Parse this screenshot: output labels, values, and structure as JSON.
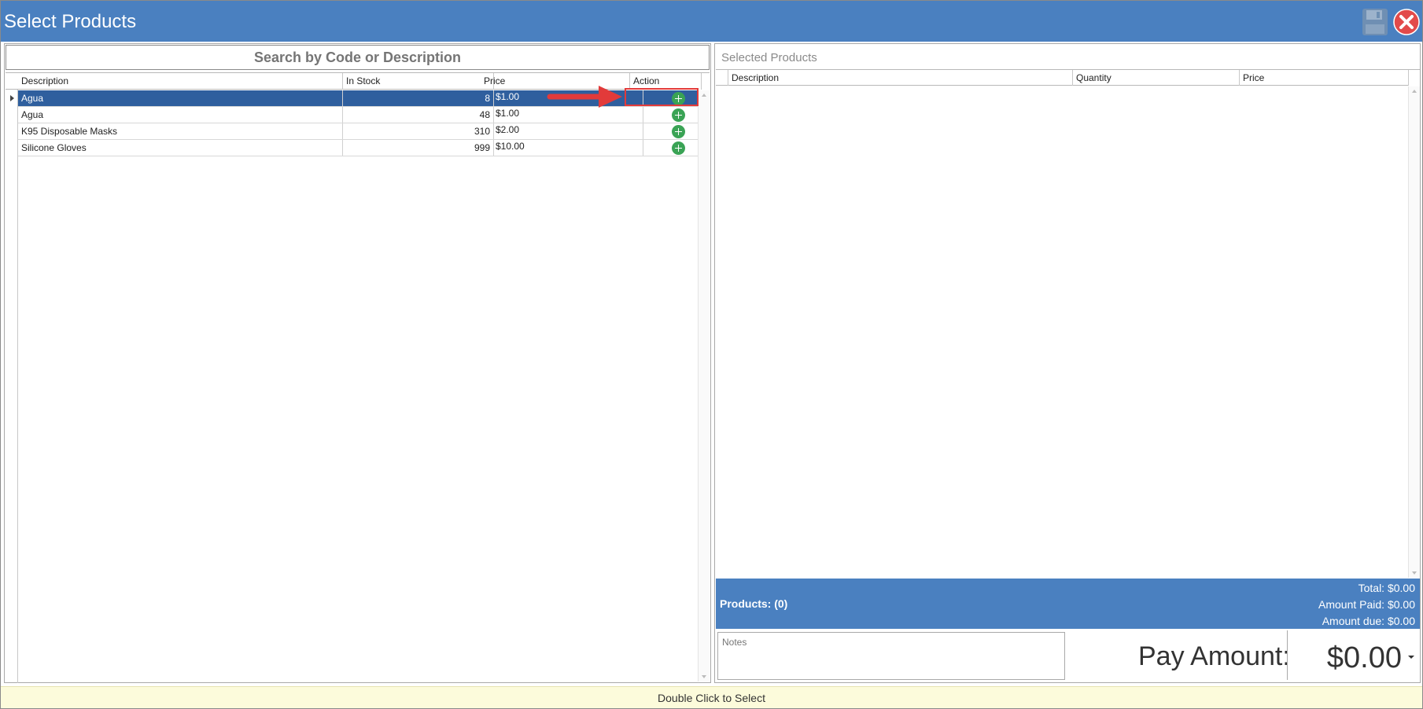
{
  "window": {
    "title": "Select Products"
  },
  "search": {
    "placeholder": "Search by Code or Description"
  },
  "products_grid": {
    "columns": [
      "Description",
      "In Stock",
      "Price",
      "Action"
    ],
    "rows": [
      {
        "description": "Agua",
        "in_stock": "8",
        "price": "$1.00",
        "selected": true
      },
      {
        "description": "Agua",
        "in_stock": "48",
        "price": "$1.00",
        "selected": false
      },
      {
        "description": "K95 Disposable Masks",
        "in_stock": "310",
        "price": "$2.00",
        "selected": false
      },
      {
        "description": "Silicone Gloves",
        "in_stock": "999",
        "price": "$10.00",
        "selected": false
      }
    ]
  },
  "selected_panel": {
    "title": "Selected Products",
    "columns": [
      "Description",
      "Quantity",
      "Price"
    ]
  },
  "summary": {
    "products_count": "Products: (0)",
    "total": "Total: $0.00",
    "amount_paid": "Amount Paid: $0.00",
    "amount_due": "Amount due: $0.00"
  },
  "notes": {
    "placeholder": "Notes"
  },
  "pay": {
    "label": "Pay Amount:",
    "value": "$0.00"
  },
  "status": {
    "hint": "Double Click to Select"
  },
  "colors": {
    "accent": "#4a80c0",
    "selected_row": "#2f5f9e",
    "add_green": "#3aa355",
    "annotation_red": "#e23a3a",
    "status_bg": "#fcfbdb"
  },
  "icons": {
    "save": "save-disk-icon",
    "close": "close-circle-icon",
    "add": "plus-circle-icon"
  }
}
